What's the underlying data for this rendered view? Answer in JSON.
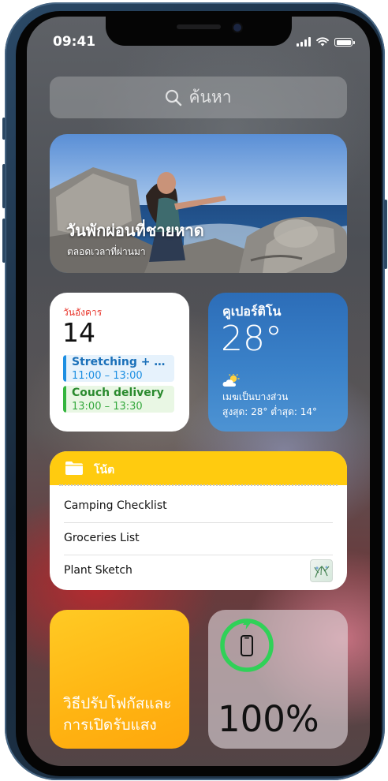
{
  "status_bar": {
    "time": "09:41"
  },
  "search": {
    "label": "ค้นหา"
  },
  "photos_widget": {
    "title": "วันพักผ่อนที่ชายหาด",
    "subtitle": "ตลอดเวลาที่ผ่านมา"
  },
  "calendar_widget": {
    "day": "วันอังคาร",
    "date": "14",
    "events": [
      {
        "title": "Stretching + weights",
        "time": "11:00 – 13:00"
      },
      {
        "title": "Couch delivery",
        "time": "13:00 – 13:30"
      }
    ]
  },
  "weather_widget": {
    "city": "คูเปอร์ติโน",
    "temperature": "28°",
    "condition": "เมฆเป็นบางส่วน",
    "range": "สูงสุด: 28° ต่ำสุด: 14°",
    "icon": "partly-cloudy-icon"
  },
  "notes_widget": {
    "title": "โน้ต",
    "items": [
      "Camping Checklist",
      "Groceries List",
      "Plant Sketch"
    ]
  },
  "tips_widget": {
    "text": "วิธีปรับโฟกัสและการเปิดรับแสง"
  },
  "battery_widget": {
    "percent": "100%",
    "level": 1.0
  },
  "colors": {
    "calendar_red": "#e8352b",
    "event_blue": "#1d8fe2",
    "event_green": "#34b53e",
    "notes_yellow": "#ffcb0f",
    "tips_yellow": "#ffb412",
    "battery_green": "#30d158",
    "weather_blue": "#3b82c9"
  }
}
